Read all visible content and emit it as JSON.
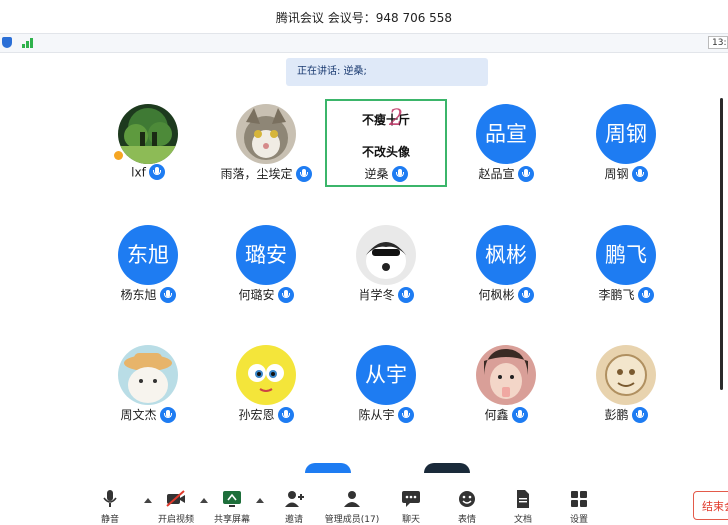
{
  "window": {
    "title": "腾讯会议 会议号：948 706 558"
  },
  "status": {
    "clock": "13:"
  },
  "speaking": {
    "text": "正在讲话: 逆桑;"
  },
  "participants": [
    {
      "name": "lxf",
      "avatar_text": ""
    },
    {
      "name": "雨落，尘埃定",
      "avatar_text": ""
    },
    {
      "name": "逆桑",
      "avatar_text": ""
    },
    {
      "name": "赵品宣",
      "avatar_text": "品宣"
    },
    {
      "name": "周钢",
      "avatar_text": "周钢"
    },
    {
      "name": "杨东旭",
      "avatar_text": "东旭"
    },
    {
      "name": "何璐安",
      "avatar_text": "璐安"
    },
    {
      "name": "肖学冬",
      "avatar_text": ""
    },
    {
      "name": "何枫彬",
      "avatar_text": "枫彬"
    },
    {
      "name": "李鹏飞",
      "avatar_text": "鹏飞"
    },
    {
      "name": "周文杰",
      "avatar_text": ""
    },
    {
      "name": "孙宏恩",
      "avatar_text": ""
    },
    {
      "name": "陈从宇",
      "avatar_text": "从宇"
    },
    {
      "name": "何鑫",
      "avatar_text": ""
    },
    {
      "name": "彭鹏",
      "avatar_text": ""
    }
  ],
  "active_tile": {
    "line1": "不瘦十斤",
    "line2": "不改头像",
    "overlay": "2"
  },
  "toolbar": {
    "mute": "静音",
    "video": "开启视频",
    "share": "共享屏幕",
    "invite": "邀请",
    "members": "管理成员(17)",
    "chat": "聊天",
    "emoji": "表情",
    "docs": "文档",
    "settings": "设置",
    "end": "结束会"
  },
  "colors": {
    "accent": "#1e7cf2",
    "active_border": "#3bb56a",
    "end": "#e0392b"
  }
}
